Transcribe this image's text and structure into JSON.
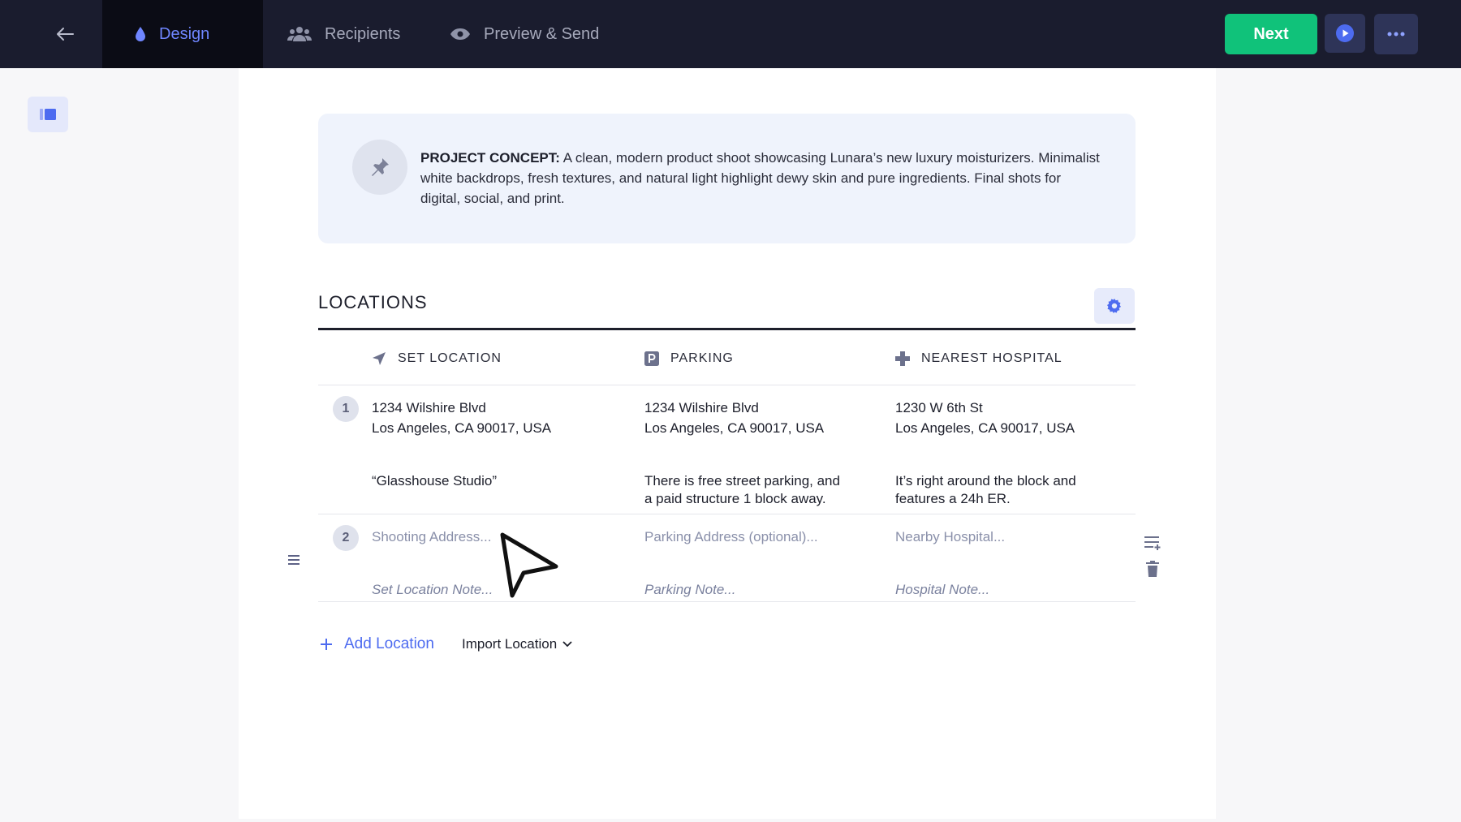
{
  "nav": {
    "tabs": [
      {
        "label": "Design",
        "icon": "drop-icon",
        "active": true
      },
      {
        "label": "Recipients",
        "icon": "people-icon"
      },
      {
        "label": "Preview & Send",
        "icon": "eye-icon"
      }
    ],
    "next_label": "Next"
  },
  "concept": {
    "heading": "PROJECT CONCEPT:",
    "body": "A clean, modern product shoot showcasing Lunara’s new luxury moisturizers. Minimalist white backdrops, fresh textures, and natural light highlight dewy skin and pure ingredients. Final shots for digital, social, and print."
  },
  "locations": {
    "title": "LOCATIONS",
    "columns": {
      "set": "SET LOCATION",
      "parking": "PARKING",
      "hospital": "NEAREST HOSPITAL"
    },
    "rows": [
      {
        "number": "1",
        "set_address_line1": "1234 Wilshire Blvd",
        "set_address_line2": "Los Angeles, CA 90017, USA",
        "set_note": "“Glasshouse Studio”",
        "parking_address_line1": "1234 Wilshire Blvd",
        "parking_address_line2": "Los Angeles, CA 90017, USA",
        "parking_note_line1": "There is free street parking, and",
        "parking_note_line2": "a paid structure 1 block away.",
        "hospital_address_line1": "1230 W 6th St",
        "hospital_address_line2": "Los Angeles, CA 90017, USA",
        "hospital_note_line1": "It’s right around the block and",
        "hospital_note_line2": "features a 24h ER."
      },
      {
        "number": "2",
        "set_address_placeholder": "Shooting Address...",
        "set_note_placeholder": "Set Location Note...",
        "parking_address_placeholder": "Parking Address (optional)...",
        "parking_note_placeholder": "Parking Note...",
        "hospital_address_placeholder": "Nearby Hospital...",
        "hospital_note_placeholder": "Hospital Note..."
      }
    ],
    "add_label": "Add Location",
    "import_label": "Import Location"
  },
  "colors": {
    "topbar": "#1a1c2e",
    "accent": "#4d6bf0",
    "next_green": "#10c27a"
  }
}
